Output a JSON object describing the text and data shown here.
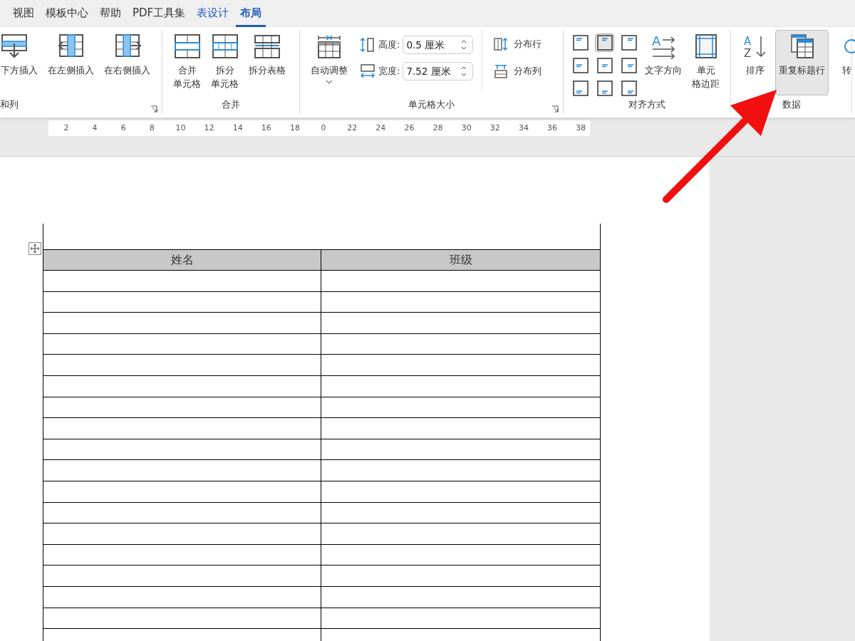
{
  "tabs": [
    {
      "label": "视图",
      "selected": false,
      "kind": "normal"
    },
    {
      "label": "模板中心",
      "selected": false,
      "kind": "normal"
    },
    {
      "label": "帮助",
      "selected": false,
      "kind": "normal"
    },
    {
      "label": "PDF工具集",
      "selected": false,
      "kind": "normal"
    },
    {
      "label": "表设计",
      "selected": false,
      "kind": "contextual"
    },
    {
      "label": "布局",
      "selected": true,
      "kind": "contextual"
    }
  ],
  "ribbon": {
    "groups": [
      {
        "label": "和列",
        "launcher": true,
        "items": [
          {
            "kind": "large",
            "lines": [
              "下方插入"
            ],
            "selected": false
          },
          {
            "kind": "large",
            "lines": [
              "在左侧插入"
            ],
            "selected": false
          },
          {
            "kind": "large",
            "lines": [
              "在右侧插入"
            ],
            "selected": false
          }
        ]
      },
      {
        "label": "合并",
        "launcher": false,
        "items": [
          {
            "kind": "large",
            "lines": [
              "合并",
              "单元格"
            ],
            "selected": false
          },
          {
            "kind": "large",
            "lines": [
              "拆分",
              "单元格"
            ],
            "selected": false
          },
          {
            "kind": "large",
            "lines": [
              "拆分表格"
            ],
            "selected": false
          }
        ]
      },
      {
        "label": "单元格大小",
        "launcher": true,
        "items": [
          {
            "kind": "large",
            "lines": [
              "自动调整"
            ],
            "selected": false,
            "dropdown": true
          },
          {
            "kind": "spinners",
            "fields": [
              {
                "label": "高度:",
                "value": "0.5 厘米"
              },
              {
                "label": "宽度:",
                "value": "7.52 厘米"
              }
            ]
          },
          {
            "kind": "smalls",
            "buttons": [
              "分布行",
              "分布列"
            ]
          }
        ]
      },
      {
        "label": "对齐方式",
        "launcher": false,
        "items": [
          {
            "kind": "align",
            "cells": [
              {
                "selected": false
              },
              {
                "selected": true
              },
              {
                "selected": false
              },
              {
                "selected": false
              },
              {
                "selected": false
              },
              {
                "selected": false
              },
              {
                "selected": false
              },
              {
                "selected": false
              },
              {
                "selected": false
              }
            ]
          },
          {
            "kind": "large",
            "lines": [
              "文字方向"
            ],
            "selected": false,
            "icon_text": [
              "A"
            ]
          },
          {
            "kind": "large",
            "lines": [
              "单元",
              "格边距"
            ],
            "selected": false
          }
        ]
      },
      {
        "label": "数据",
        "launcher": false,
        "items": [
          {
            "kind": "large",
            "lines": [
              "排序"
            ],
            "selected": false,
            "icon_text": [
              "A",
              "Z"
            ]
          },
          {
            "kind": "large",
            "lines": [
              "重复标题行"
            ],
            "selected": true
          },
          {
            "kind": "large",
            "lines": [
              "转"
            ],
            "selected": false
          }
        ]
      }
    ]
  },
  "ruler": {
    "labels": [
      "2",
      "4",
      "6",
      "8",
      "10",
      "12",
      "14",
      "16",
      "18",
      "0",
      "22",
      "24",
      "26",
      "28",
      "30",
      "32",
      "34",
      "36",
      "38"
    ]
  },
  "table": {
    "columns": [
      "姓名",
      "班级"
    ]
  }
}
